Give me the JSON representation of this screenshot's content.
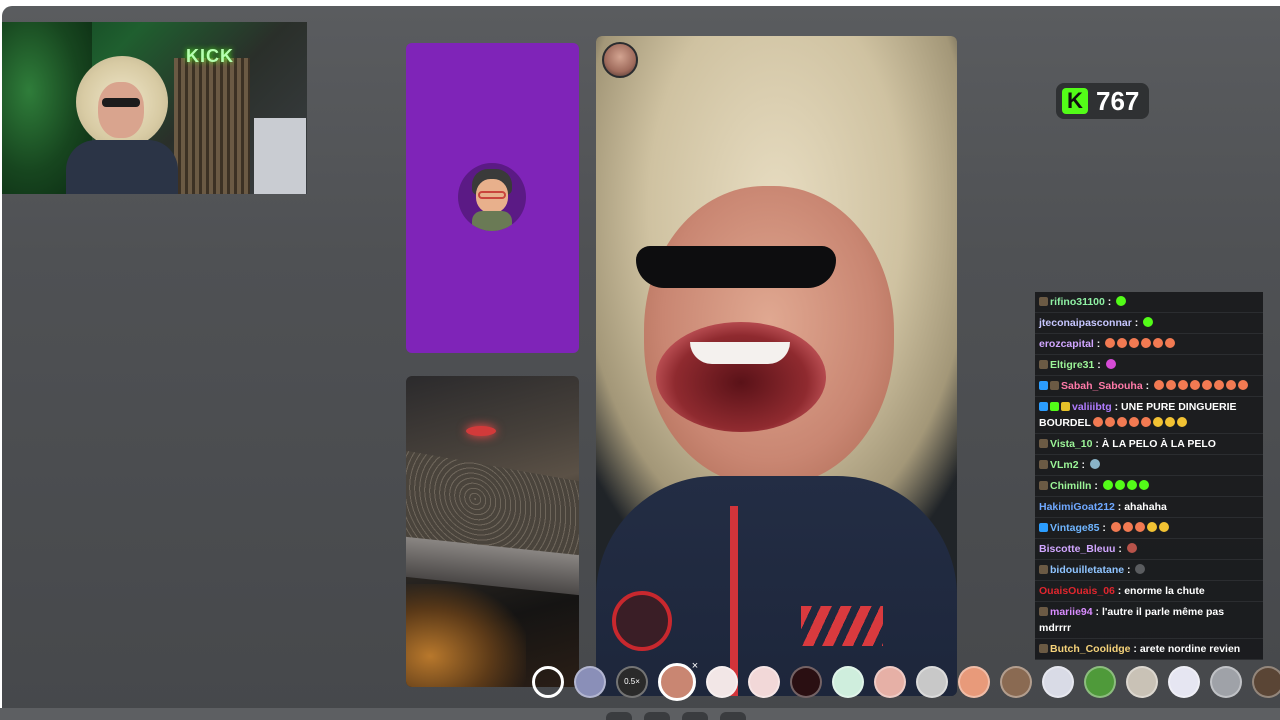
{
  "webcam": {
    "sign_text": "KICK"
  },
  "viewer_badge": {
    "logo_letter": "K",
    "count": "767",
    "accent": "#53fc18"
  },
  "chat": {
    "messages": [
      {
        "user": "rifino31100",
        "user_color": "#8ff0a4",
        "badges": [
          "#6b5a44"
        ],
        "text": "",
        "emotes": [
          "#53fc18"
        ]
      },
      {
        "user": "jteconaipasconnar",
        "user_color": "#c7c7ff",
        "badges": [],
        "text": "",
        "emotes": [
          "#53fc18"
        ]
      },
      {
        "user": "erozcapital",
        "user_color": "#d1a6ff",
        "badges": [],
        "text": "",
        "emotes": [
          "#f27a52",
          "#f27a52",
          "#f27a52",
          "#f27a52",
          "#f27a52",
          "#f27a52"
        ]
      },
      {
        "user": "Eltigre31",
        "user_color": "#9cf598",
        "badges": [
          "#6b5a44"
        ],
        "text": "",
        "emotes": [
          "#d64bd6"
        ]
      },
      {
        "user": "Sabah_Sabouha",
        "user_color": "#ff7aa8",
        "badges": [
          "#2b9dff",
          "#6b5a44"
        ],
        "text": "",
        "emotes": [
          "#f27a52",
          "#f27a52",
          "#f27a52",
          "#f27a52",
          "#f27a52",
          "#f27a52",
          "#f27a52",
          "#f27a52"
        ]
      },
      {
        "user": "valiiibtg",
        "user_color": "#b07bff",
        "badges": [
          "#2b9dff",
          "#53fc18",
          "#e6c229"
        ],
        "text": "UNE PURE DINGUERIE BOURDEL",
        "emotes": [
          "#f27a52",
          "#f27a52",
          "#f27a52",
          "#f27a52",
          "#f27a52",
          "#f2c233",
          "#f2c233",
          "#f2c233"
        ]
      },
      {
        "user": "Vista_10",
        "user_color": "#9cf598",
        "badges": [
          "#6b5a44"
        ],
        "text": "À LA PELO À LA PELO",
        "emotes": []
      },
      {
        "user": "VLm2",
        "user_color": "#9cf598",
        "badges": [
          "#6b5a44"
        ],
        "text": "",
        "emotes": [
          "#8ab4c8"
        ]
      },
      {
        "user": "Chimilln",
        "user_color": "#9cf598",
        "badges": [
          "#6b5a44"
        ],
        "text": "",
        "emotes": [
          "#53fc18",
          "#53fc18",
          "#53fc18",
          "#53fc18"
        ]
      },
      {
        "user": "HakimiGoat212",
        "user_color": "#6fa8ff",
        "badges": [],
        "text": "ahahaha",
        "emotes": []
      },
      {
        "user": "Vintage85",
        "user_color": "#6fb5ff",
        "badges": [
          "#2b9dff"
        ],
        "text": "",
        "emotes": [
          "#f27a52",
          "#f27a52",
          "#f27a52",
          "#f2c233",
          "#f2c233"
        ]
      },
      {
        "user": "Biscotte_Bleuu",
        "user_color": "#d1a6ff",
        "badges": [],
        "text": "",
        "emotes": [
          "#b8534a"
        ]
      },
      {
        "user": "bidouilletatane",
        "user_color": "#8fc4ff",
        "badges": [
          "#6b5a44"
        ],
        "text": "",
        "emotes": [
          "#5a5c5f"
        ]
      },
      {
        "user": "OuaisOuais_06",
        "user_color": "#e0262e",
        "badges": [],
        "text": "enorme la chute",
        "emotes": []
      },
      {
        "user": "mariie94",
        "user_color": "#d98cff",
        "badges": [
          "#6b5a44"
        ],
        "text": "l'autre il parle même pas mdrrrr",
        "emotes": []
      },
      {
        "user": "Butch_Coolidge",
        "user_color": "#f5d27a",
        "badges": [
          "#6b5a44"
        ],
        "text": "arete nordine revien",
        "emotes": []
      }
    ]
  },
  "filters": [
    {
      "name": "filter-none",
      "color": "transparent",
      "label": ""
    },
    {
      "name": "filter-blur",
      "color": "#8a8fb8",
      "label": ""
    },
    {
      "name": "filter-speed",
      "color": "#2a2a2a",
      "label": "0.5×"
    },
    {
      "name": "filter-bigmouth",
      "color": "#c98672",
      "label": "",
      "selected": true
    },
    {
      "name": "filter-white-face",
      "color": "#f2e6e6",
      "label": ""
    },
    {
      "name": "filter-blush-face",
      "color": "#f2d8d8",
      "label": ""
    },
    {
      "name": "filter-devil",
      "color": "#2a0f12",
      "label": ""
    },
    {
      "name": "filter-green-face",
      "color": "#cfeedd",
      "label": ""
    },
    {
      "name": "filter-peach",
      "color": "#e6b0a6",
      "label": ""
    },
    {
      "name": "filter-shades",
      "color": "#c8c8c8",
      "label": ""
    },
    {
      "name": "filter-orange",
      "color": "#e89a7a",
      "label": ""
    },
    {
      "name": "filter-puppy",
      "color": "#8a6a52",
      "label": ""
    },
    {
      "name": "filter-robot",
      "color": "#d9dbe6",
      "label": ""
    },
    {
      "name": "filter-alien",
      "color": "#4f9a3a",
      "label": ""
    },
    {
      "name": "filter-horse",
      "color": "#c9c2b6",
      "label": ""
    },
    {
      "name": "filter-stars",
      "color": "#e6e6f2",
      "label": ""
    },
    {
      "name": "filter-grey",
      "color": "#9fa2a8",
      "label": ""
    },
    {
      "name": "filter-monkey",
      "color": "#5a4535",
      "label": ""
    }
  ]
}
